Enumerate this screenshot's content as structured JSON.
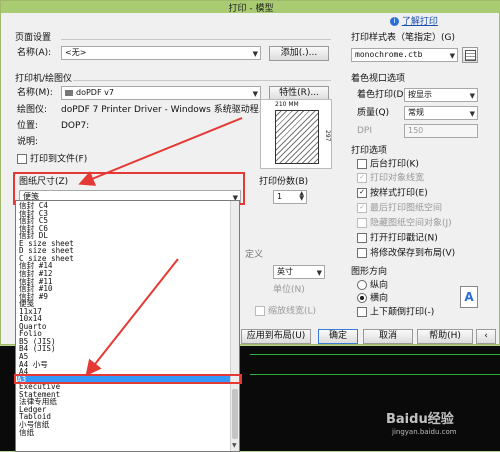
{
  "window": {
    "title": "打印 - 模型"
  },
  "help_link": "了解打印",
  "page_setup": {
    "group": "页面设置",
    "name_label": "名称(A):",
    "name_value": "<无>",
    "add_button": "添加(.)..."
  },
  "printer": {
    "group": "打印机/绘图仪",
    "name_label": "名称(M):",
    "name_value": "doPDF v7",
    "properties_button": "特性(R)...",
    "plotter_label": "绘图仪:",
    "plotter_value": "doPDF 7 Printer Driver - Windows 系统驱动程...",
    "location_label": "位置:",
    "location_value": "DOP7:",
    "desc_label": "说明:",
    "print_to_file": "打印到文件(F)",
    "preview_dim_w": "210 MM",
    "preview_dim_h": "297"
  },
  "paper_size": {
    "label": "图纸尺寸(Z)",
    "selected": "便笺",
    "options": [
      "信封 C4",
      "信封 C3",
      "信封 C5",
      "信封 C6",
      "信封 DL",
      "E size sheet",
      "D size sheet",
      "C size sheet",
      "信封 #14",
      "信封 #12",
      "信封 #11",
      "信封 #10",
      "信封 #9",
      "便笺",
      "11x17",
      "10x14",
      "Quarto",
      "Folio",
      "B5 (JIS)",
      "B4 (JIS)",
      "A5",
      "A4 小号",
      "A4",
      "A3",
      "Executive",
      "Statement",
      "法律专用纸",
      "Ledger",
      "Tabloid",
      "小号信纸",
      "信纸"
    ],
    "highlighted_index": 23
  },
  "copies": {
    "label": "打印份数(B)",
    "value": "1"
  },
  "partially_hidden": {
    "unit_value": "英寸",
    "unit_label": "单位(N)",
    "scale_lineweights": "缩放线宽(L)",
    "custom_frag": "定义"
  },
  "plot_style": {
    "group": "打印样式表（笔指定）(G)",
    "value": "monochrome.ctb"
  },
  "shaded_viewport": {
    "group": "着色视口选项",
    "shade_label": "着色打印(D)",
    "shade_value": "按显示",
    "quality_label": "质量(Q)",
    "quality_value": "常规",
    "dpi_label": "DPI",
    "dpi_value": "150"
  },
  "plot_options": {
    "group": "打印选项",
    "items": [
      {
        "label": "后台打印(K)",
        "checked": false,
        "enabled": true
      },
      {
        "label": "打印对象线宽",
        "checked": true,
        "enabled": false
      },
      {
        "label": "按样式打印(E)",
        "checked": true,
        "enabled": true
      },
      {
        "label": "最后打印图纸空间",
        "checked": true,
        "enabled": false
      },
      {
        "label": "隐藏图纸空间对象(J)",
        "checked": false,
        "enabled": false
      },
      {
        "label": "打开打印戳记(N)",
        "checked": false,
        "enabled": true
      },
      {
        "label": "将修改保存到布局(V)",
        "checked": false,
        "enabled": true
      }
    ]
  },
  "orientation": {
    "group": "图形方向",
    "portrait": "纵向",
    "landscape": "横向",
    "upside_down": "上下颠倒打印(-)",
    "selected": "landscape"
  },
  "buttons": {
    "apply_layout": "应用到布局(U)",
    "ok": "确定",
    "cancel": "取消",
    "help": "帮助(H)"
  },
  "watermark": "Baidu经验",
  "watermark_url": "jingyan.baidu.com",
  "colors": {
    "highlight": "#3399ff",
    "annotation": "#e53935"
  }
}
